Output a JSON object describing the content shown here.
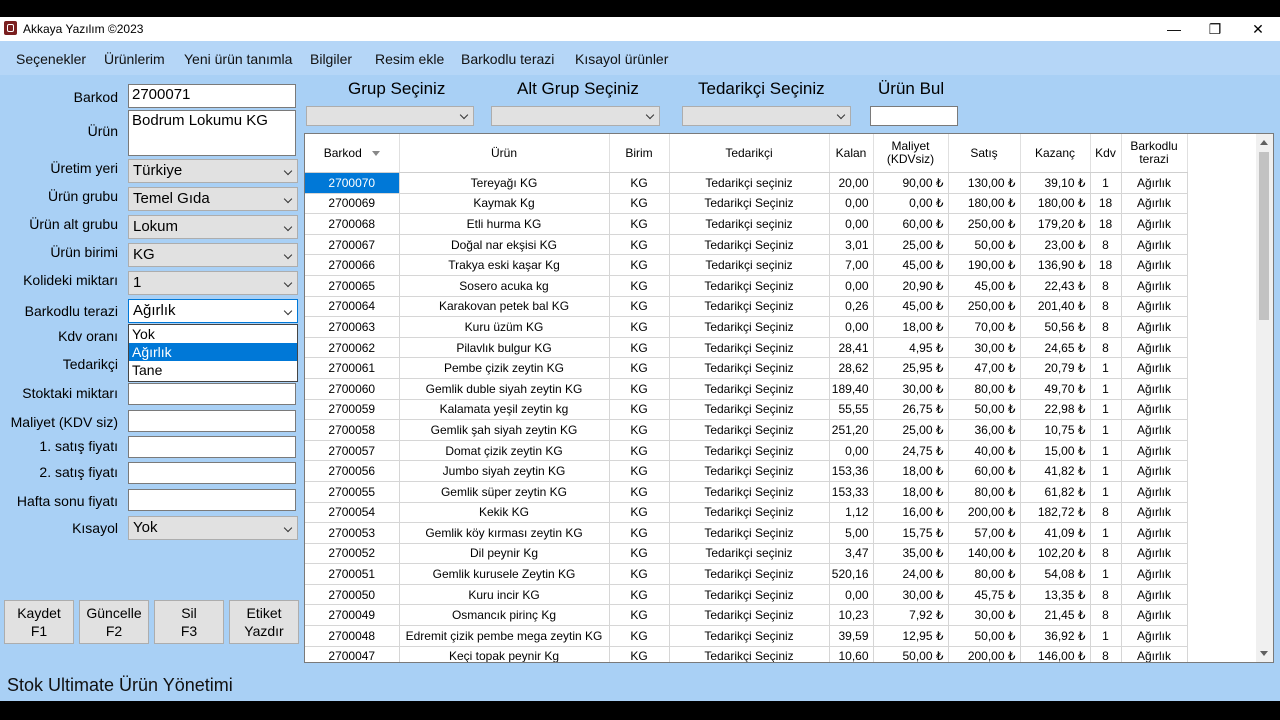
{
  "window": {
    "title": "Akkaya Yazılım ©2023"
  },
  "menu": [
    "Seçenekler",
    "Ürünlerim",
    "Yeni ürün tanımla",
    "Bilgiler",
    "Resim ekle",
    "Barkodlu terazi",
    "Kısayol ürünler"
  ],
  "form": {
    "barkod_label": "Barkod",
    "barkod_value": "2700071",
    "urun_label": "Ürün",
    "urun_value": "Bodrum Lokumu KG",
    "uretim_label": "Üretim yeri",
    "uretim_value": "Türkiye",
    "grup_label": "Ürün grubu",
    "grup_value": "Temel Gıda",
    "altgrup_label": "Ürün alt grubu",
    "altgrup_value": "Lokum",
    "birim_label": "Ürün birimi",
    "birim_value": "KG",
    "koli_label": "Kolideki miktarı",
    "koli_value": "1",
    "terazi_label": "Barkodlu terazi",
    "terazi_value": "Ağırlık",
    "kdv_label": "Kdv oranı",
    "tedarikci_label": "Tedarikçi",
    "stok_label": "Stoktaki miktarı",
    "maliyet_label": "Maliyet (KDV siz)",
    "satis1_label": "1. satış fiyatı",
    "satis2_label": "2. satış fiyatı",
    "hafta_label": "Hafta sonu fiyatı",
    "kisayol_label": "Kısayol",
    "kisayol_value": "Yok",
    "terazi_options": [
      "Yok",
      "Ağırlık",
      "Tane"
    ]
  },
  "buttons": {
    "kaydet": [
      "Kaydet",
      "F1"
    ],
    "guncelle": [
      "Güncelle",
      "F2"
    ],
    "sil": [
      "Sil",
      "F3"
    ],
    "etiket": [
      "Etiket",
      "Yazdır"
    ]
  },
  "filters": {
    "grup": "Grup Seçiniz",
    "altgrup": "Alt Grup Seçiniz",
    "tedarikci": "Tedarikçi Seçiniz",
    "urunbul": "Ürün Bul"
  },
  "table": {
    "headers": [
      "Barkod",
      "Ürün",
      "Birim",
      "Tedarikçi",
      "Kalan",
      "Maliyet (KDVsiz)",
      "Satış",
      "Kazanç",
      "Kdv",
      "Barkodlu terazi"
    ],
    "rows": [
      [
        "2700070",
        "Tereyağı KG",
        "KG",
        "Tedarikçi seçiniz",
        "20,00",
        "90,00 ₺",
        "130,00 ₺",
        "39,10 ₺",
        "1",
        "Ağırlık"
      ],
      [
        "2700069",
        "Kaymak Kg",
        "KG",
        "Tedarikçi Seçiniz",
        "0,00",
        "0,00 ₺",
        "180,00 ₺",
        "180,00 ₺",
        "18",
        "Ağırlık"
      ],
      [
        "2700068",
        "Etli hurma KG",
        "KG",
        "Tedarikçi seçiniz",
        "0,00",
        "60,00 ₺",
        "250,00 ₺",
        "179,20 ₺",
        "18",
        "Ağırlık"
      ],
      [
        "2700067",
        "Doğal nar ekşisi KG",
        "KG",
        "Tedarikçi Seçiniz",
        "3,01",
        "25,00 ₺",
        "50,00 ₺",
        "23,00 ₺",
        "8",
        "Ağırlık"
      ],
      [
        "2700066",
        "Trakya eski kaşar Kg",
        "KG",
        "Tedarikçi seçiniz",
        "7,00",
        "45,00 ₺",
        "190,00 ₺",
        "136,90 ₺",
        "18",
        "Ağırlık"
      ],
      [
        "2700065",
        "Sosero acuka kg",
        "KG",
        "Tedarikçi Seçiniz",
        "0,00",
        "20,90 ₺",
        "45,00 ₺",
        "22,43 ₺",
        "8",
        "Ağırlık"
      ],
      [
        "2700064",
        "Karakovan petek  bal KG",
        "KG",
        "Tedarikçi Seçiniz",
        "0,26",
        "45,00 ₺",
        "250,00 ₺",
        "201,40 ₺",
        "8",
        "Ağırlık"
      ],
      [
        "2700063",
        "Kuru üzüm  KG",
        "KG",
        "Tedarikçi Seçiniz",
        "0,00",
        "18,00 ₺",
        "70,00 ₺",
        "50,56 ₺",
        "8",
        "Ağırlık"
      ],
      [
        "2700062",
        "Pilavlık bulgur KG",
        "KG",
        "Tedarikçi Seçiniz",
        "28,41",
        "4,95 ₺",
        "30,00 ₺",
        "24,65 ₺",
        "8",
        "Ağırlık"
      ],
      [
        "2700061",
        "Pembe çizik zeytin KG",
        "KG",
        "Tedarikçi Seçiniz",
        "28,62",
        "25,95 ₺",
        "47,00 ₺",
        "20,79 ₺",
        "1",
        "Ağırlık"
      ],
      [
        "2700060",
        "Gemlik duble siyah zeytin KG",
        "KG",
        "Tedarikçi Seçiniz",
        "189,40",
        "30,00 ₺",
        "80,00 ₺",
        "49,70 ₺",
        "1",
        "Ağırlık"
      ],
      [
        "2700059",
        "Kalamata yeşil zeytin kg",
        "KG",
        "Tedarikçi Seçiniz",
        "55,55",
        "26,75 ₺",
        "50,00 ₺",
        "22,98 ₺",
        "1",
        "Ağırlık"
      ],
      [
        "2700058",
        "Gemlik şah siyah zeytin  KG",
        "KG",
        "Tedarikçi Seçiniz",
        "251,20",
        "25,00 ₺",
        "36,00 ₺",
        "10,75 ₺",
        "1",
        "Ağırlık"
      ],
      [
        "2700057",
        "Domat çizik zeytin KG",
        "KG",
        "Tedarikçi Seçiniz",
        "0,00",
        "24,75 ₺",
        "40,00 ₺",
        "15,00 ₺",
        "1",
        "Ağırlık"
      ],
      [
        "2700056",
        "Jumbo siyah zeytin  KG",
        "KG",
        "Tedarikçi Seçiniz",
        "153,36",
        "18,00 ₺",
        "60,00 ₺",
        "41,82 ₺",
        "1",
        "Ağırlık"
      ],
      [
        "2700055",
        "Gemlik süper  zeytin  KG",
        "KG",
        "Tedarikçi Seçiniz",
        "153,33",
        "18,00 ₺",
        "80,00 ₺",
        "61,82 ₺",
        "1",
        "Ağırlık"
      ],
      [
        "2700054",
        "Kekik KG",
        "KG",
        "Tedarikçi Seçiniz",
        "1,12",
        "16,00 ₺",
        "200,00 ₺",
        "182,72 ₺",
        "8",
        "Ağırlık"
      ],
      [
        "2700053",
        "Gemlik köy kırması zeytin  KG",
        "KG",
        "Tedarikçi Seçiniz",
        "5,00",
        "15,75 ₺",
        "57,00 ₺",
        "41,09 ₺",
        "1",
        "Ağırlık"
      ],
      [
        "2700052",
        "Dil peynir Kg",
        "KG",
        "Tedarikçi seçiniz",
        "3,47",
        "35,00 ₺",
        "140,00 ₺",
        "102,20 ₺",
        "8",
        "Ağırlık"
      ],
      [
        "2700051",
        "Gemlik kurusele Zeytin KG",
        "KG",
        "Tedarikçi Seçiniz",
        "520,16",
        "24,00 ₺",
        "80,00 ₺",
        "54,08 ₺",
        "1",
        "Ağırlık"
      ],
      [
        "2700050",
        "Kuru incir KG",
        "KG",
        "Tedarikçi Seçiniz",
        "0,00",
        "30,00 ₺",
        "45,75 ₺",
        "13,35 ₺",
        "8",
        "Ağırlık"
      ],
      [
        "2700049",
        "Osmancık pirinç Kg",
        "KG",
        "Tedarikçi Seçiniz",
        "10,23",
        "7,92 ₺",
        "30,00 ₺",
        "21,45 ₺",
        "8",
        "Ağırlık"
      ],
      [
        "2700048",
        "Edremit çizik pembe mega zeytin KG",
        "KG",
        "Tedarikçi Seçiniz",
        "39,59",
        "12,95 ₺",
        "50,00 ₺",
        "36,92 ₺",
        "1",
        "Ağırlık"
      ],
      [
        "2700047",
        "Keçi topak peynir Kg",
        "KG",
        "Tedarikçi Seçiniz",
        "10,60",
        "50,00 ₺",
        "200,00 ₺",
        "146,00 ₺",
        "8",
        "Ağırlık"
      ]
    ]
  },
  "status": "Stok Ultimate Ürün Yönetimi"
}
